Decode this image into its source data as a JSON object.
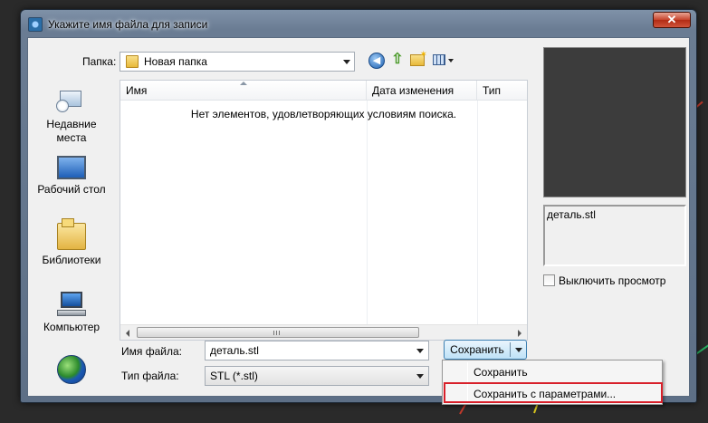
{
  "window": {
    "title": "Укажите имя файла для записи",
    "close_label": "✕"
  },
  "toolbar": {
    "folder_label": "Папка:",
    "folder_value": "Новая папка"
  },
  "places": [
    {
      "label": "Недавние места"
    },
    {
      "label": "Рабочий стол"
    },
    {
      "label": "Библиотеки"
    },
    {
      "label": "Компьютер"
    },
    {
      "label": ""
    }
  ],
  "list": {
    "columns": [
      "Имя",
      "Дата изменения",
      "Тип"
    ],
    "empty_message": "Нет элементов, удовлетворяющих условиям поиска.",
    "scroll_grip": "III"
  },
  "preview": {
    "file_name": "деталь.stl",
    "disable_preview_label": "Выключить просмотр"
  },
  "form": {
    "filename_label": "Имя файла:",
    "filename_value": "деталь.stl",
    "filetype_label": "Тип файла:",
    "filetype_value": "STL (*.stl)",
    "save_label": "Сохранить"
  },
  "save_menu": {
    "items": [
      "Сохранить",
      "Сохранить с параметрами..."
    ]
  },
  "colors": {
    "highlight_border": "#d8202a",
    "desktop_lines": [
      "#c0392b",
      "#27ae60",
      "#d4c21e"
    ]
  }
}
